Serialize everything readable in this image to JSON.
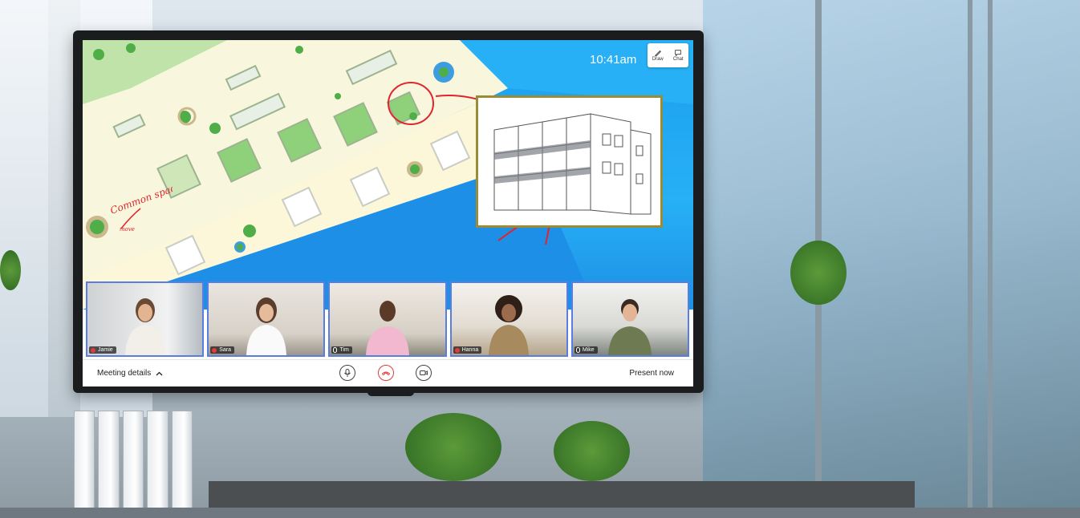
{
  "screen": {
    "clock": "10:41am",
    "tools": [
      {
        "label": "Draw",
        "icon": "pen-icon"
      },
      {
        "label": "Chat",
        "icon": "chat-icon"
      }
    ],
    "annotations": {
      "common_space": "Common space",
      "move": "move"
    }
  },
  "participants": [
    {
      "name": "Jamie",
      "mic": "muted"
    },
    {
      "name": "Sara",
      "mic": "muted"
    },
    {
      "name": "Tim",
      "mic": "on"
    },
    {
      "name": "Hanna",
      "mic": "muted"
    },
    {
      "name": "Mike",
      "mic": "on"
    }
  ],
  "bottom_bar": {
    "meeting_details": "Meeting details",
    "present_now": "Present now",
    "controls": [
      {
        "icon": "microphone-icon"
      },
      {
        "icon": "hang-up-icon"
      },
      {
        "icon": "camera-icon"
      }
    ]
  },
  "colors": {
    "canvas_blue": "#1a9ff0",
    "tile_border": "#5a7de0",
    "hang_up": "#e23b3b",
    "sketch_frame": "#9a8b37"
  }
}
